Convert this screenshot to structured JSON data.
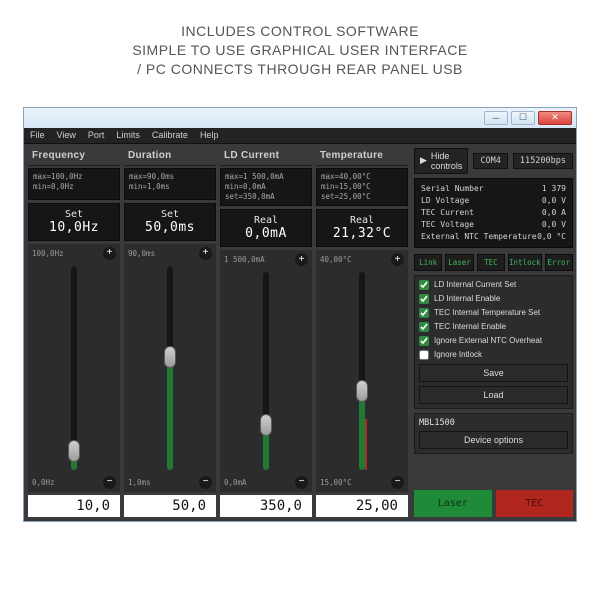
{
  "heading": {
    "line1": "INCLUDES CONTROL SOFTWARE",
    "line2": "SIMPLE TO USE GRAPHICAL USER INTERFACE",
    "line3": "/ PC CONNECTS THROUGH REAR PANEL USB"
  },
  "menu": [
    "File",
    "View",
    "Port",
    "Limits",
    "Calibrate",
    "Help"
  ],
  "hide_controls_label": "Hide controls",
  "port_label": "COM4",
  "baud_label": "115200bps",
  "panels": {
    "frequency": {
      "title": "Frequency",
      "info": [
        "max=100,0Hz",
        "min=0,0Hz"
      ],
      "readout_label": "Set",
      "readout_value": "10,0Hz",
      "top_label": "100,0Hz",
      "bottom_label": "0,0Hz",
      "value_box": "10,0",
      "fill_pct": 10
    },
    "duration": {
      "title": "Duration",
      "info": [
        "max=90,0ms",
        "min=1,0ms"
      ],
      "readout_label": "Set",
      "readout_value": "50,0ms",
      "top_label": "90,0ms",
      "bottom_label": "1,0ms",
      "value_box": "50,0",
      "fill_pct": 55
    },
    "ld_current": {
      "title": "LD Current",
      "info": [
        "max=1 500,0mA",
        "min=0,0mA",
        "set=350,0mA"
      ],
      "readout_label": "Real",
      "readout_value": "0,0mA",
      "top_label": "1 500,0mA",
      "bottom_label": "0,0mA",
      "value_box": "350,0",
      "fill_pct": 23
    },
    "temperature": {
      "title": "Temperature",
      "info": [
        "max=40,00°C",
        "min=15,00°C",
        "set=25,00°C"
      ],
      "readout_label": "Real",
      "readout_value": "21,32°C",
      "top_label": "40,00°C",
      "bottom_label": "15,00°C",
      "value_box": "25,00",
      "fill_pct": 40,
      "real_pct": 25
    }
  },
  "status": [
    {
      "label": "Serial Number",
      "value": "1 379"
    },
    {
      "label": "LD Voltage",
      "value": "0,0  V"
    },
    {
      "label": "TEC Current",
      "value": "0,0  A"
    },
    {
      "label": "TEC Voltage",
      "value": "0,0  V"
    },
    {
      "label": "External NTC Temperature",
      "value": "0,0 °C"
    }
  ],
  "indicators": [
    "Link",
    "Laser",
    "TEC",
    "Intlock",
    "Error"
  ],
  "checkboxes": [
    {
      "label": "LD Internal Current Set",
      "checked": true
    },
    {
      "label": "LD Internal Enable",
      "checked": true
    },
    {
      "label": "TEC Internal Temperature Set",
      "checked": true
    },
    {
      "label": "TEC Internal Enable",
      "checked": true
    },
    {
      "label": "Ignore External NTC Overheat",
      "checked": true
    },
    {
      "label": "Ignore Intlock",
      "checked": false
    }
  ],
  "buttons": {
    "save": "Save",
    "load": "Load",
    "device_options": "Device options"
  },
  "device_label": "MBL1500",
  "big_buttons": {
    "laser": "Laser",
    "tec": "TEC"
  }
}
